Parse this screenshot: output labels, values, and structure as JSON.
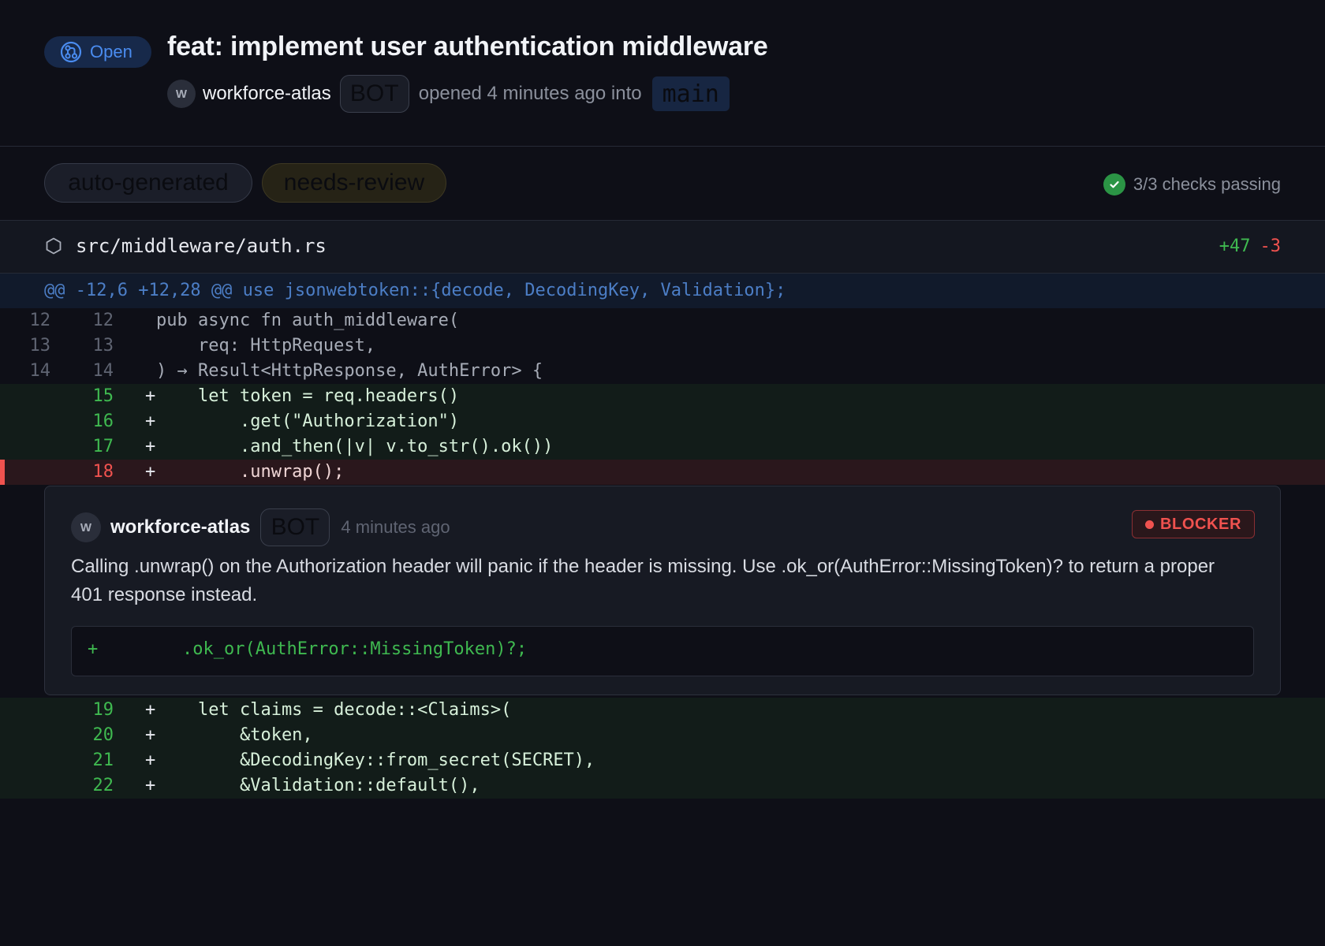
{
  "pr": {
    "status": "Open",
    "title": "feat: implement user authentication middleware",
    "author": "workforce-atlas",
    "author_initial": "W",
    "bot_badge": "BOT",
    "opened_text": "opened 4 minutes ago into",
    "branch": "main"
  },
  "labels": [
    "auto-generated",
    "needs-review"
  ],
  "checks": {
    "text": "3/3 checks passing"
  },
  "file": {
    "path": "src/middleware/auth.rs",
    "additions": "+47",
    "deletions": "-3"
  },
  "hunk": "@@ -12,6 +12,28 @@ use jsonwebtoken::{decode, DecodingKey, Validation};",
  "lines_before": [
    {
      "old": "12",
      "new": "12",
      "sign": "",
      "code": "pub async fn auth_middleware(",
      "type": "ctx"
    },
    {
      "old": "13",
      "new": "13",
      "sign": "",
      "code": "    req: HttpRequest,",
      "type": "ctx"
    },
    {
      "old": "14",
      "new": "14",
      "sign": "",
      "code": ") → Result<HttpResponse, AuthError> {",
      "type": "ctx"
    },
    {
      "old": "",
      "new": "15",
      "sign": "+",
      "code": "    let token = req.headers()",
      "type": "add"
    },
    {
      "old": "",
      "new": "16",
      "sign": "+",
      "code": "        .get(\"Authorization\")",
      "type": "add"
    },
    {
      "old": "",
      "new": "17",
      "sign": "+",
      "code": "        .and_then(|v| v.to_str().ok())",
      "type": "add"
    },
    {
      "old": "",
      "new": "18",
      "sign": "+",
      "code": "        .unwrap();",
      "type": "flag"
    }
  ],
  "comment": {
    "author": "workforce-atlas",
    "author_initial": "W",
    "bot_badge": "BOT",
    "time": "4 minutes ago",
    "severity": "BLOCKER",
    "body": "Calling .unwrap() on the Authorization header will panic if the header is missing. Use .ok_or(AuthError::MissingToken)? to return a proper 401 response instead.",
    "suggestion_sign": "+",
    "suggestion_code": ".ok_or(AuthError::MissingToken)?;"
  },
  "lines_after": [
    {
      "old": "",
      "new": "19",
      "sign": "+",
      "code": "    let claims = decode::<Claims>(",
      "type": "add"
    },
    {
      "old": "",
      "new": "20",
      "sign": "+",
      "code": "        &token,",
      "type": "add"
    },
    {
      "old": "",
      "new": "21",
      "sign": "+",
      "code": "        &DecodingKey::from_secret(SECRET),",
      "type": "add"
    },
    {
      "old": "",
      "new": "22",
      "sign": "+",
      "code": "        &Validation::default(),",
      "type": "add"
    }
  ],
  "colors": {
    "background": "#0e0f17",
    "open_blue": "#4a8cf0",
    "add_green": "#3fb950",
    "delete_red": "#f0524f",
    "check_green": "#2b9445"
  },
  "icons": {
    "status": "git-pull-request-icon",
    "file": "hexagon-file-icon",
    "checks": "check-circle-icon",
    "severity": "red-dot-icon"
  }
}
